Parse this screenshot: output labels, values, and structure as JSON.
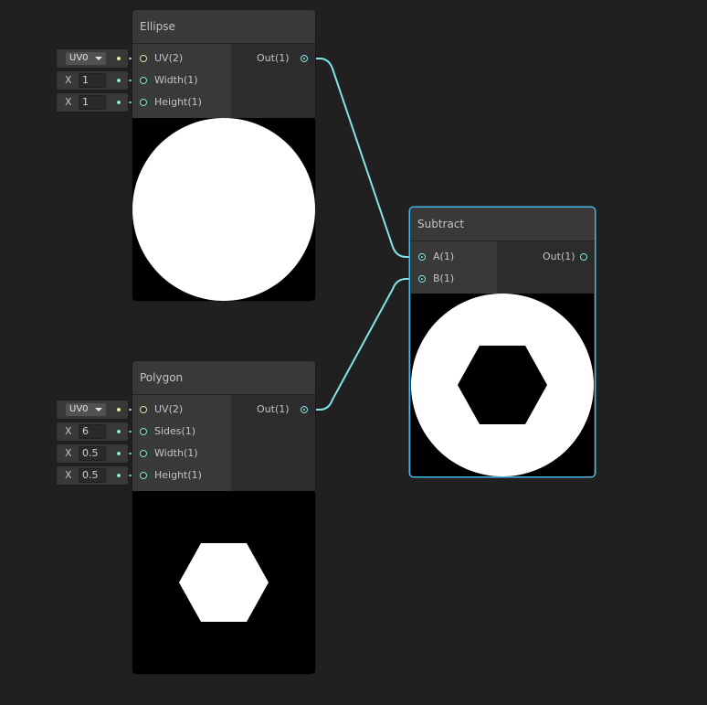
{
  "colors": {
    "background": "#202020",
    "node_body": "#2b2b2b",
    "node_header": "#393939",
    "wire": "#84e4e7",
    "uv_wire": "#cbf4a8",
    "selection": "#44b8e6",
    "preview_shape": "#ffffff",
    "preview_background": "#000000"
  },
  "ellipse_node": {
    "title": "Ellipse",
    "inputs": [
      {
        "label": "UV(2)",
        "type": "uv"
      },
      {
        "label": "Width(1)",
        "type": "float"
      },
      {
        "label": "Height(1)",
        "type": "float"
      }
    ],
    "output": "Out(1)",
    "fields": {
      "uv": "UV0",
      "width": {
        "axis": "X",
        "value": "1"
      },
      "height": {
        "axis": "X",
        "value": "1"
      }
    },
    "preview": "circle"
  },
  "polygon_node": {
    "title": "Polygon",
    "inputs": [
      {
        "label": "UV(2)",
        "type": "uv"
      },
      {
        "label": "Sides(1)",
        "type": "float"
      },
      {
        "label": "Width(1)",
        "type": "float"
      },
      {
        "label": "Height(1)",
        "type": "float"
      }
    ],
    "output": "Out(1)",
    "fields": {
      "uv": "UV0",
      "sides": {
        "axis": "X",
        "value": "6"
      },
      "width": {
        "axis": "X",
        "value": "0.5"
      },
      "height": {
        "axis": "X",
        "value": "0.5"
      }
    },
    "preview": "hexagon"
  },
  "subtract_node": {
    "title": "Subtract",
    "inputs": [
      {
        "label": "A(1)",
        "type": "float"
      },
      {
        "label": "B(1)",
        "type": "float"
      }
    ],
    "output": "Out(1)",
    "selected": true,
    "preview": "circle-minus-hexagon"
  },
  "connections": [
    {
      "from": "Ellipse.Out(1)",
      "to": "Subtract.A(1)"
    },
    {
      "from": "Polygon.Out(1)",
      "to": "Subtract.B(1)"
    }
  ]
}
